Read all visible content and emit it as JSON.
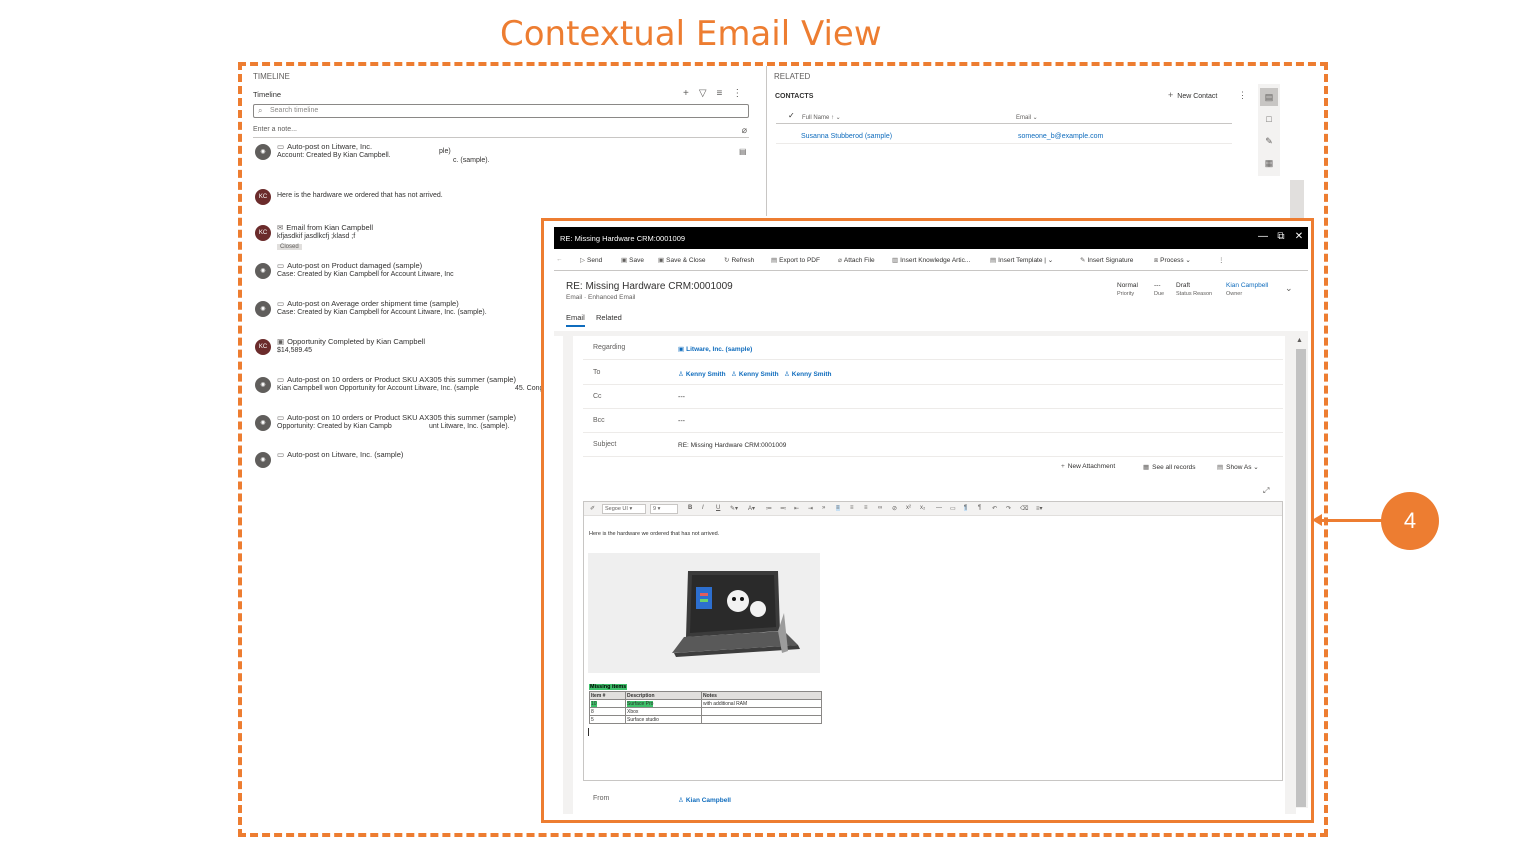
{
  "heading": "Contextual Email View",
  "callout": "4",
  "colors": {
    "accent": "#ed7d31",
    "link": "#0f6cbd",
    "highlight": "#3ec06a"
  },
  "timeline": {
    "label": "TIMELINE",
    "subheading": "Timeline",
    "search_placeholder": "Search timeline",
    "note_placeholder": "Enter a note...",
    "icons": {
      "add": "plus-icon",
      "filter": "filter-icon",
      "list": "list-icon",
      "more": "more-icon",
      "attach": "paperclip-icon",
      "search": "search-icon"
    },
    "items": [
      {
        "avatar": "",
        "title": "Auto-post on Litware, Inc.",
        "line2": "Account: Created By Kian Campbell.",
        "extra": "ple)",
        "extra2": "c. (sample)."
      },
      {
        "avatar": "KC",
        "title": "",
        "line2": "Here is the hardware we ordered that has not arrived."
      },
      {
        "avatar": "KC",
        "title": "Email from Kian Campbell",
        "line2": "kfjasdkif jasdlkcfj ;klasd ;f",
        "badge": "Closed"
      },
      {
        "avatar": "",
        "title": "Auto-post on Product damaged (sample)",
        "line2": "Case: Created by Kian Campbell for Account Litware, Inc"
      },
      {
        "avatar": "",
        "title": "Auto-post on Average order shipment time (sample)",
        "line2": "Case: Created by Kian Campbell for Account Litware, Inc. (sample)."
      },
      {
        "avatar": "KC",
        "title": "Opportunity Completed by Kian Campbell",
        "line2": "$14,589.45"
      },
      {
        "avatar": "",
        "title": "Auto-post on 10 orders or Product SKU AX305 this summer (sample)",
        "line2": "Kian Campbell won Opportunity for Account Litware, Inc. (sample",
        "extra": "45. Congrat"
      },
      {
        "avatar": "",
        "title": "Auto-post on 10 orders or Product SKU AX305 this summer (sample)",
        "line2": "Opportunity: Created by Kian Campb",
        "extra": "unt Litware, Inc. (sample)."
      },
      {
        "avatar": "",
        "title": "Auto-post on Litware, Inc. (sample)",
        "line2": ""
      }
    ]
  },
  "related": {
    "label": "RELATED",
    "contacts_label": "CONTACTS",
    "new_contact": "New Contact",
    "columns": [
      "Full Name",
      "Email"
    ],
    "rows": [
      {
        "name": "Susanna Stubberod (sample)",
        "email": "someone_b@example.com"
      }
    ]
  },
  "email": {
    "window_title": "RE: Missing Hardware CRM:0001009",
    "commands": [
      "Send",
      "Save",
      "Save & Close",
      "Refresh",
      "Export to PDF",
      "Attach File",
      "Insert Knowledge Artic...",
      "Insert Template",
      "Insert Signature",
      "Process"
    ],
    "record_title": "RE: Missing Hardware CRM:0001009",
    "record_sub": "Email · Enhanced Email",
    "header_fields": [
      {
        "value": "Normal",
        "label": "Priority"
      },
      {
        "value": "---",
        "label": "Due"
      },
      {
        "value": "Draft",
        "label": "Status Reason"
      },
      {
        "value": "Kian Campbell",
        "label": "Owner"
      }
    ],
    "tabs": [
      "Email",
      "Related"
    ],
    "fields": {
      "regarding_label": "Regarding",
      "regarding_value": "Litware, Inc. (sample)",
      "to_label": "To",
      "to_values": [
        "Kenny Smith",
        "Kenny Smith",
        "Kenny Smith"
      ],
      "cc_label": "Cc",
      "cc_value": "---",
      "bcc_label": "Bcc",
      "bcc_value": "---",
      "subject_label": "Subject",
      "subject_value": "RE: Missing Hardware CRM:0001009",
      "from_label": "From",
      "from_value": "Kian Campbell"
    },
    "attachments_bar": [
      "New Attachment",
      "See all records",
      "Show As"
    ],
    "editor": {
      "font": "Segoe UI",
      "size": "9",
      "body_text": "Here is the hardware we ordered that has not arrived.",
      "missing_heading": "Missing items",
      "table_headers": [
        "Item #",
        "Description",
        "Notes"
      ],
      "table_rows": [
        [
          "10",
          "Surface Pro",
          "with additional RAM"
        ],
        [
          "8",
          "Xbox",
          ""
        ],
        [
          "5",
          "Surface studio",
          ""
        ]
      ]
    }
  }
}
